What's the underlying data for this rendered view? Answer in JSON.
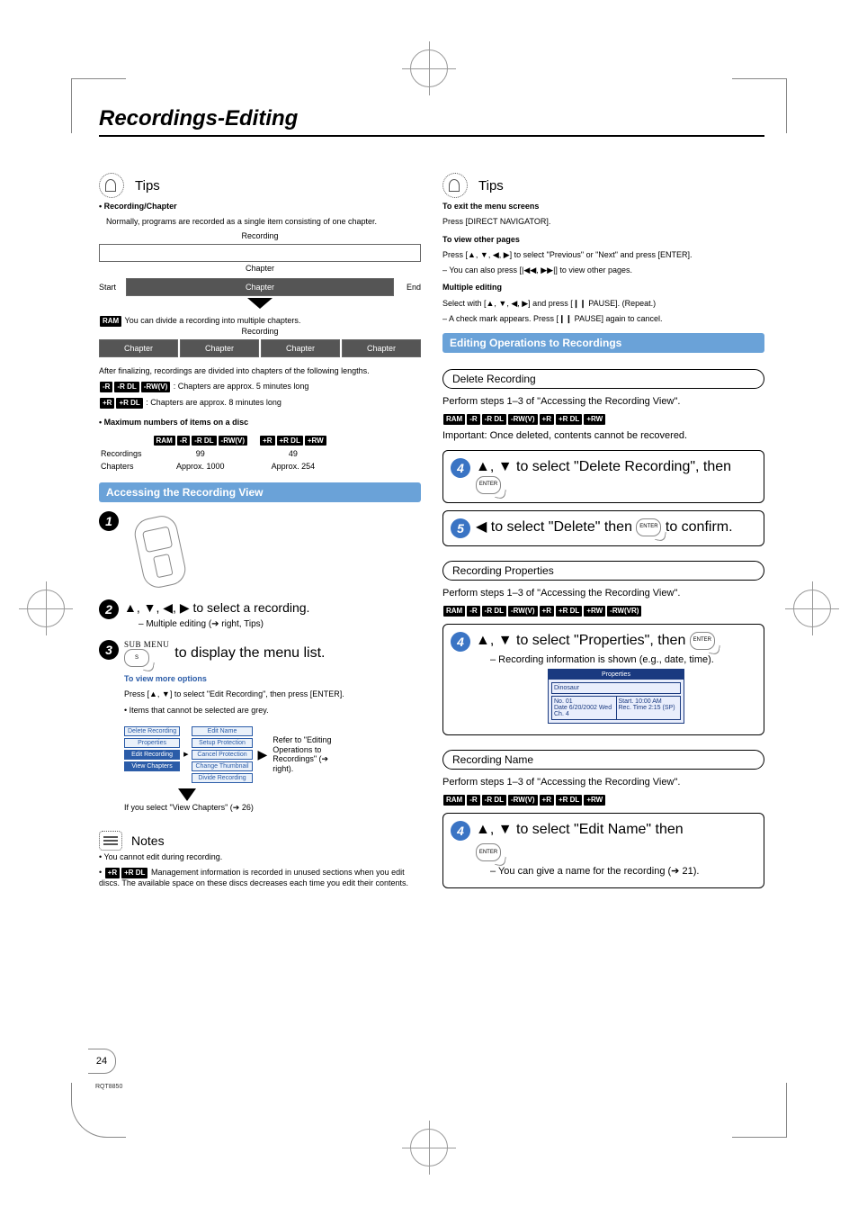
{
  "page": {
    "title": "Recordings-Editing",
    "number": "24",
    "footer_code": "RQT8850"
  },
  "left": {
    "tips": {
      "title": "Tips",
      "h1": "• Recording/Chapter",
      "p1": "Normally, programs are recorded as a single item consisting of one chapter.",
      "recording_label": "Recording",
      "chapter_label": "Chapter",
      "start": "Start",
      "end": "End",
      "ram_note": " You can divide a recording into multiple chapters.",
      "recording_label2": "Recording",
      "chapter_cells": [
        "Chapter",
        "Chapter",
        "Chapter",
        "Chapter"
      ],
      "after_final": "After finalizing, recordings are divided into chapters of the following lengths.",
      "chap5": " : Chapters are approx. 5 minutes long",
      "chap8": " : Chapters are approx. 8 minutes long",
      "max_h": "• Maximum numbers of items on a disc",
      "badges_a": [
        "RAM",
        "-R",
        "-R DL",
        "-RW(V)"
      ],
      "badges_b": [
        "+R",
        "+R DL",
        "+RW"
      ],
      "tbl": {
        "r1c1": "Recordings",
        "r1c2": "99",
        "r1c3": "49",
        "r2c1": "Chapters",
        "r2c2": "Approx. 1000",
        "r2c3": "Approx. 254"
      }
    },
    "access": {
      "bar": "Accessing the Recording View",
      "step2": "▲, ▼, ◀, ▶ to select a recording.",
      "step2_sub": "– Multiple editing (➔ right, Tips)",
      "step3_pre": "SUB MENU",
      "step3": " to display the menu list.",
      "view_more": "To view more options",
      "view_more_p": "Press [▲, ▼] to select \"Edit Recording\", then press [ENTER].",
      "view_more_b": "• Items that cannot be selected are grey.",
      "menu": {
        "colA": [
          "Delete Recording",
          "Properties",
          "Edit Recording",
          "View Chapters"
        ],
        "colB": [
          "Edit Name",
          "Setup Protection",
          "Cancel Protection",
          "Change Thumbnail",
          "Divide Recording"
        ]
      },
      "refer": "Refer to \"Editing Operations to Recordings\" (➔ right).",
      "if_view": "If you select \"View Chapters\" (➔ 26)"
    },
    "notes": {
      "title": "Notes",
      "n1": "• You cannot edit during recording.",
      "n2": " Management information is recorded in unused sections when you edit discs. The available space on these discs decreases each time you edit their contents."
    }
  },
  "right": {
    "tips": {
      "title": "Tips",
      "exit_h": "To exit the menu screens",
      "exit_p": "Press [DIRECT NAVIGATOR].",
      "other_h": "To view other pages",
      "other_p1": "Press [▲, ▼, ◀, ▶] to select \"Previous\" or \"Next\" and press [ENTER].",
      "other_p2": "– You can also press [|◀◀, ▶▶|] to view other pages.",
      "multi_h": "Multiple editing",
      "multi_p1": "Select with [▲, ▼, ◀, ▶] and press [❙❙ PAUSE]. (Repeat.)",
      "multi_p2": "– A check mark appears. Press [❙❙ PAUSE] again to cancel."
    },
    "edit": {
      "bar": "Editing Operations to Recordings",
      "del_pill": "Delete Recording",
      "del_p": "Perform steps 1–3 of \"Accessing the Recording View\".",
      "del_badges": [
        "RAM",
        "-R",
        "-R DL",
        "-RW(V)",
        "+R",
        "+R DL",
        "+RW"
      ],
      "del_imp": "Important: Once deleted, contents cannot be recovered.",
      "s4": "▲, ▼ to select \"Delete Recording\", then ",
      "s5a": "◀ to select \"Delete\" then ",
      "s5b": " to confirm.",
      "prop_pill": "Recording Properties",
      "prop_p": "Perform steps 1–3 of \"Accessing the Recording View\".",
      "prop_badges": [
        "RAM",
        "-R",
        "-R DL",
        "-RW(V)",
        "+R",
        "+R DL",
        "+RW",
        "-RW(VR)"
      ],
      "s4b": "▲, ▼ to select \"Properties\", then ",
      "s4b_sub": "– Recording information is shown (e.g., date, time).",
      "panel": {
        "title": "Properties",
        "name": "Dinosaur",
        "no": "No.   01",
        "date": "Date  6/20/2002 Wed",
        "ch": "Ch.   4",
        "start": "Start.       10:00 AM",
        "rec": "Rec. Time 2:15 (SP)"
      },
      "name_pill": "Recording Name",
      "name_p": "Perform steps 1–3 of \"Accessing the Recording View\".",
      "name_badges": [
        "RAM",
        "-R",
        "-R DL",
        "-RW(V)",
        "+R",
        "+R DL",
        "+RW"
      ],
      "s4c": "▲, ▼ to select \"Edit Name\" then",
      "s4c_sub": "– You can give a name for the recording (➔ 21)."
    }
  },
  "enter_label": "ENTER",
  "s_label": "S"
}
